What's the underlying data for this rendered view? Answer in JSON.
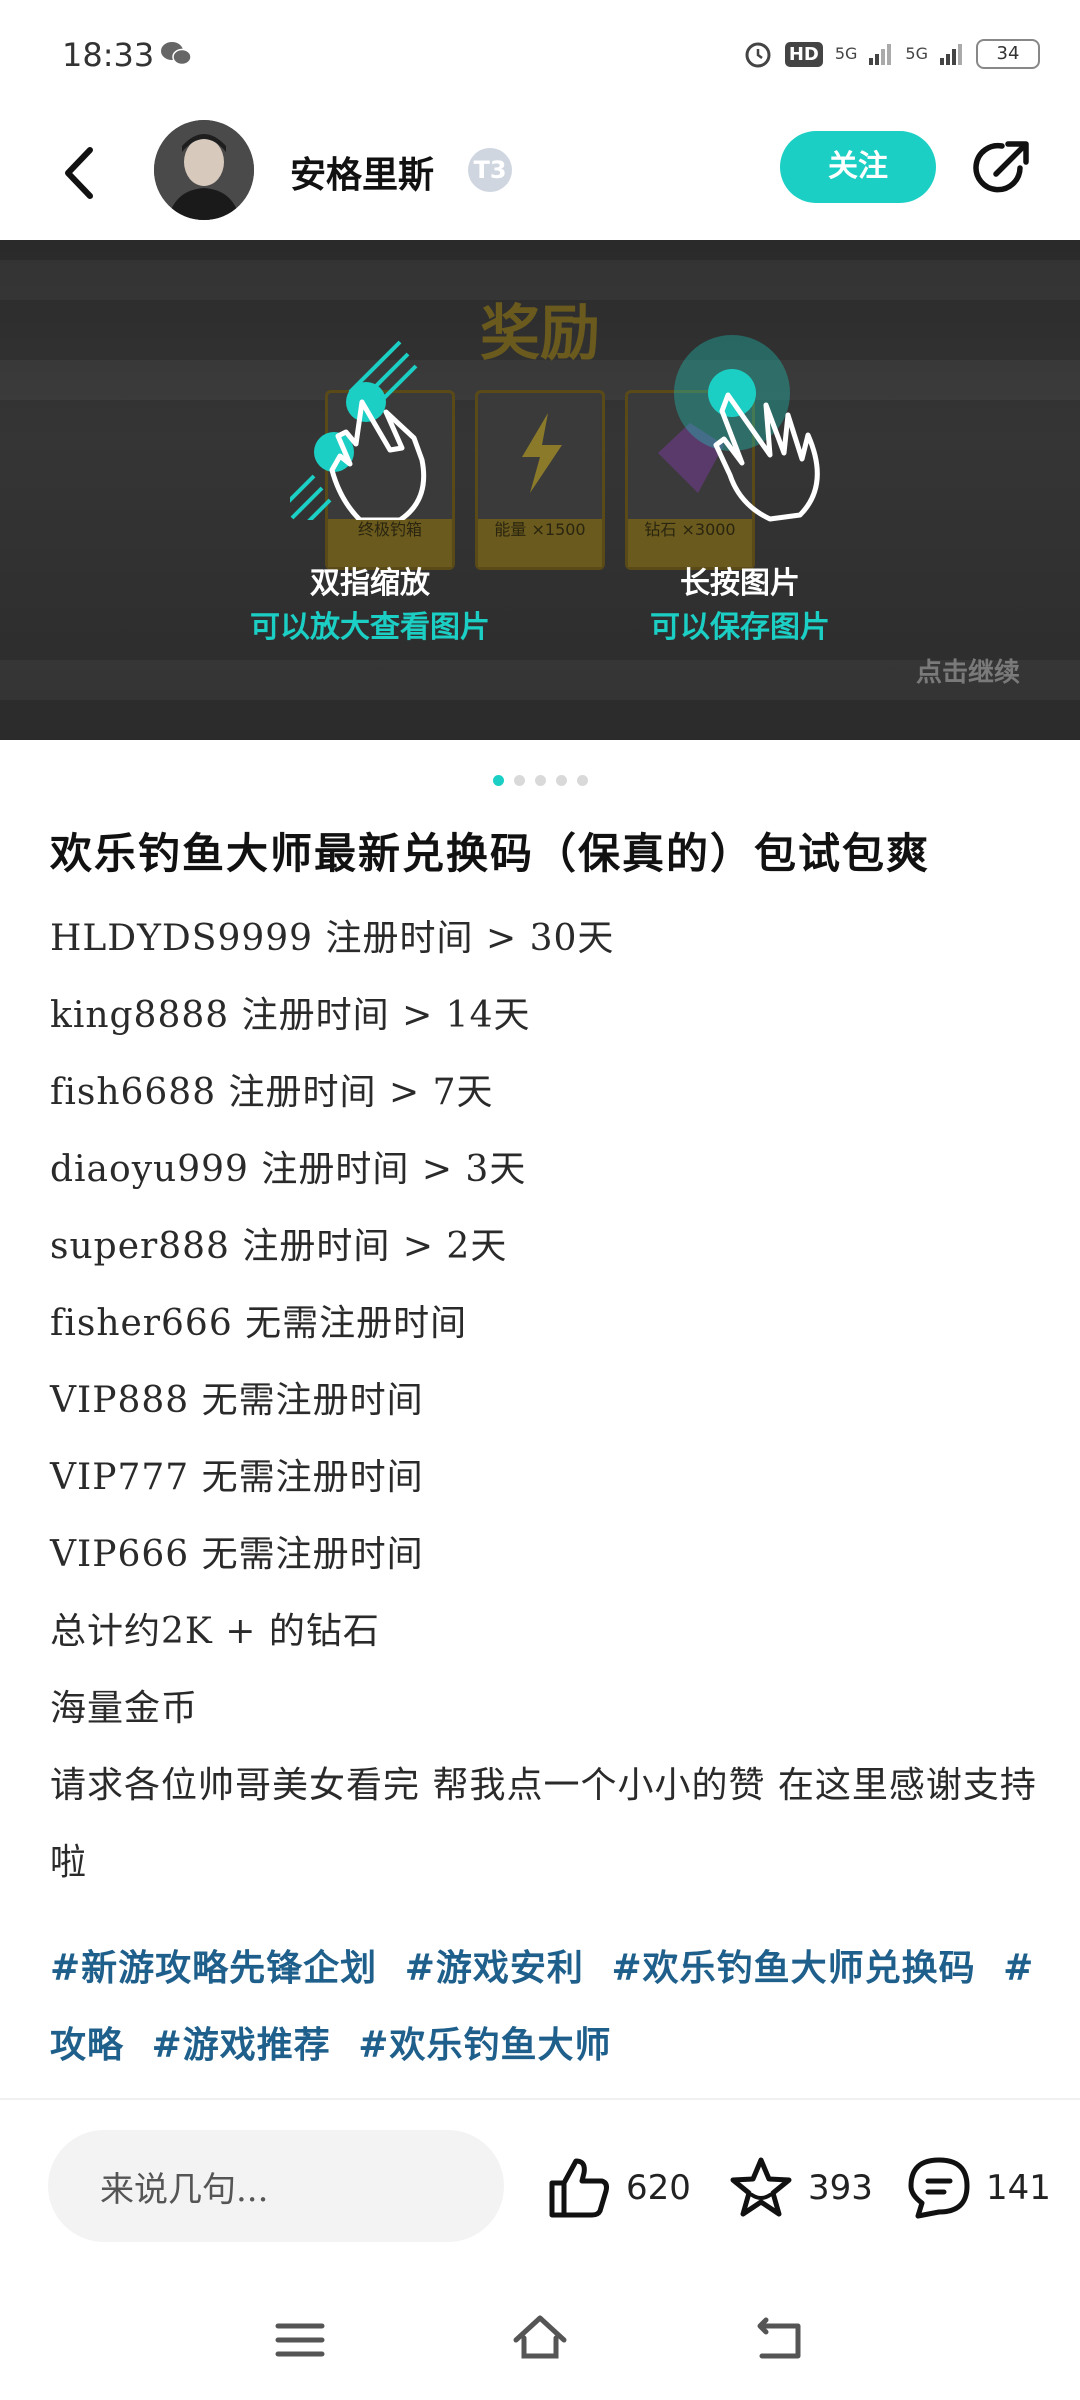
{
  "status_bar": {
    "time": "18:33",
    "hd": "HD",
    "signal1": "5G",
    "signal2": "5G",
    "battery": "34"
  },
  "header": {
    "username": "安格里斯",
    "level": "T3",
    "follow_label": "关注"
  },
  "banner": {
    "title": "奖励",
    "cards": [
      "终极钓箱",
      "能量 ×1500",
      "钻石 ×3000"
    ],
    "tip1_title": "双指缩放",
    "tip1_sub": "可以放大查看图片",
    "tip2_title": "长按图片",
    "tip2_sub": "可以保存图片",
    "continue": "点击继续",
    "page_count": 5,
    "active_page": 1
  },
  "post": {
    "title": "欢乐钓鱼大师最新兑换码（保真的）包试包爽",
    "lines": [
      "HLDYDS9999 注册时间 > 30天",
      "king8888 注册时间 > 14天",
      "fish6688 注册时间 > 7天",
      "diaoyu999 注册时间 > 3天",
      "super888 注册时间 > 2天",
      "fisher666 无需注册时间",
      "VIP888 无需注册时间",
      "VIP777 无需注册时间",
      "VIP666 无需注册时间",
      "总计约2K + 的钻石",
      "海量金币",
      "请求各位帅哥美女看完 帮我点一个小小的赞 在这里感谢支持啦"
    ],
    "tags": [
      "#新游攻略先锋企划",
      "#游戏安利",
      "#欢乐钓鱼大师兑换码",
      "#攻略",
      "#游戏推荐",
      "#欢乐钓鱼大师"
    ]
  },
  "actions": {
    "comment_placeholder": "来说几句...",
    "likes": "620",
    "favorites": "393",
    "comments": "141"
  },
  "colors": {
    "accent": "#1ccfc4",
    "tag": "#1f5f8b"
  }
}
